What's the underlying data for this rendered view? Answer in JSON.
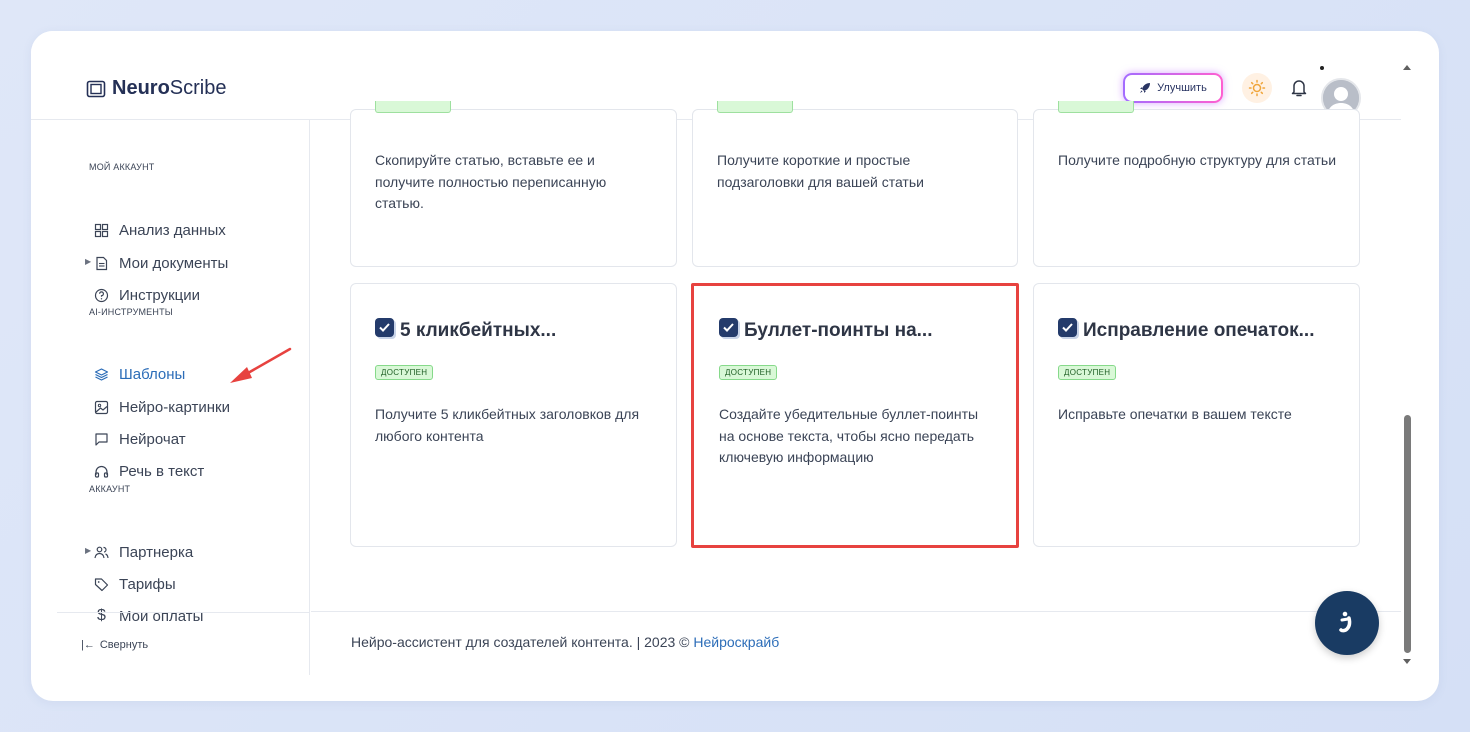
{
  "brand": {
    "bold": "Neuro",
    "light": "Scribe"
  },
  "header": {
    "upgrade_label": "Улучшить"
  },
  "sidebar": {
    "section_account": "МОЙ АККАУНТ",
    "items_account": [
      {
        "label": "Анализ данных",
        "icon": "grid-icon"
      },
      {
        "label": "Мои документы",
        "icon": "document-icon"
      },
      {
        "label": "Инструкции",
        "icon": "question-circle-icon"
      }
    ],
    "section_ai": "AI-ИНСТРУМЕНТЫ",
    "items_ai": [
      {
        "label": "Шаблоны",
        "icon": "layers-icon"
      },
      {
        "label": "Нейро-картинки",
        "icon": "image-icon"
      },
      {
        "label": "Нейрочат",
        "icon": "chat-icon"
      },
      {
        "label": "Речь в текст",
        "icon": "headphones-icon"
      }
    ],
    "section_acc2": "АККАУНТ",
    "items_acc2": [
      {
        "label": "Партнерка",
        "icon": "users-icon"
      },
      {
        "label": "Тарифы",
        "icon": "tag-icon"
      },
      {
        "label": "Мои оплаты",
        "icon": "dollar-icon"
      }
    ],
    "collapse_label": "Свернуть"
  },
  "cards_top": [
    {
      "desc": "Скопируйте статью, вставьте ее и получите полностью переписанную статью."
    },
    {
      "desc": "Получите короткие и простые подзаголовки для вашей статьи"
    },
    {
      "desc": "Получите подробную структуру для статьи"
    }
  ],
  "cards_bottom": [
    {
      "title": "5 кликбейтных...",
      "badge": "ДОСТУПЕН",
      "desc": "Получите 5 кликбейтных заголовков для любого контента"
    },
    {
      "title": "Буллет-поинты на...",
      "badge": "ДОСТУПЕН",
      "desc": "Создайте убедительные буллет-поинты на основе текста, чтобы ясно передать ключевую информацию"
    },
    {
      "title": "Исправление опечаток...",
      "badge": "ДОСТУПЕН",
      "desc": "Исправьте опечатки в вашем тексте"
    }
  ],
  "footer": {
    "text": "Нейро-ассистент для создателей контента.  | 2023 © ",
    "link": "Нейроскрайб"
  },
  "colors": {
    "accent": "#2c6db8",
    "highlight": "#e7423f",
    "badge_bg": "#d9f8d7"
  }
}
